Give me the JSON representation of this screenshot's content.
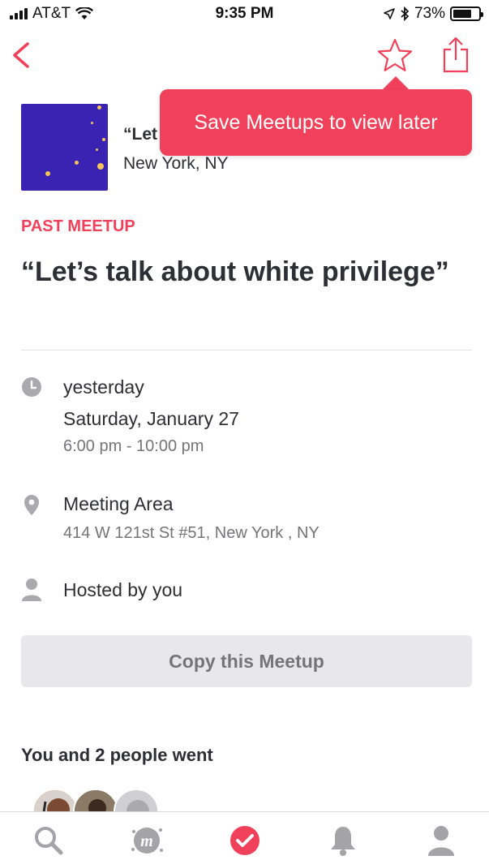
{
  "status_bar": {
    "carrier": "AT&T",
    "time": "9:35 PM",
    "battery": "73%",
    "battery_level": 0.73
  },
  "nav": {
    "back_icon": "chevron-left-icon",
    "star_icon": "star-outline-icon",
    "share_icon": "share-icon"
  },
  "tooltip": {
    "text": "Save Meetups to view later"
  },
  "group": {
    "name": "“Let",
    "location": "New York, NY"
  },
  "event": {
    "status": "PAST MEETUP",
    "title": "“Let’s talk about white privilege”",
    "date_relative": "yesterday",
    "date_full": "Saturday, January 27",
    "time_range": "6:00 pm - 10:00 pm",
    "venue_name": "Meeting Area",
    "venue_address": "414 W 121st St #51, New York , NY",
    "host_text": "Hosted by you",
    "copy_button": "Copy this Meetup"
  },
  "attendees": {
    "title": "You and 2 people went"
  },
  "tab_bar": {
    "items": [
      "search-icon",
      "meetup-logo-icon",
      "check-circle-icon",
      "bell-icon",
      "profile-icon"
    ],
    "active": "check-circle-icon"
  },
  "colors": {
    "accent": "#f1415a",
    "group_thumb": "#3a22b3",
    "muted_text": "#757579",
    "button_bg": "#e8e8eb"
  }
}
